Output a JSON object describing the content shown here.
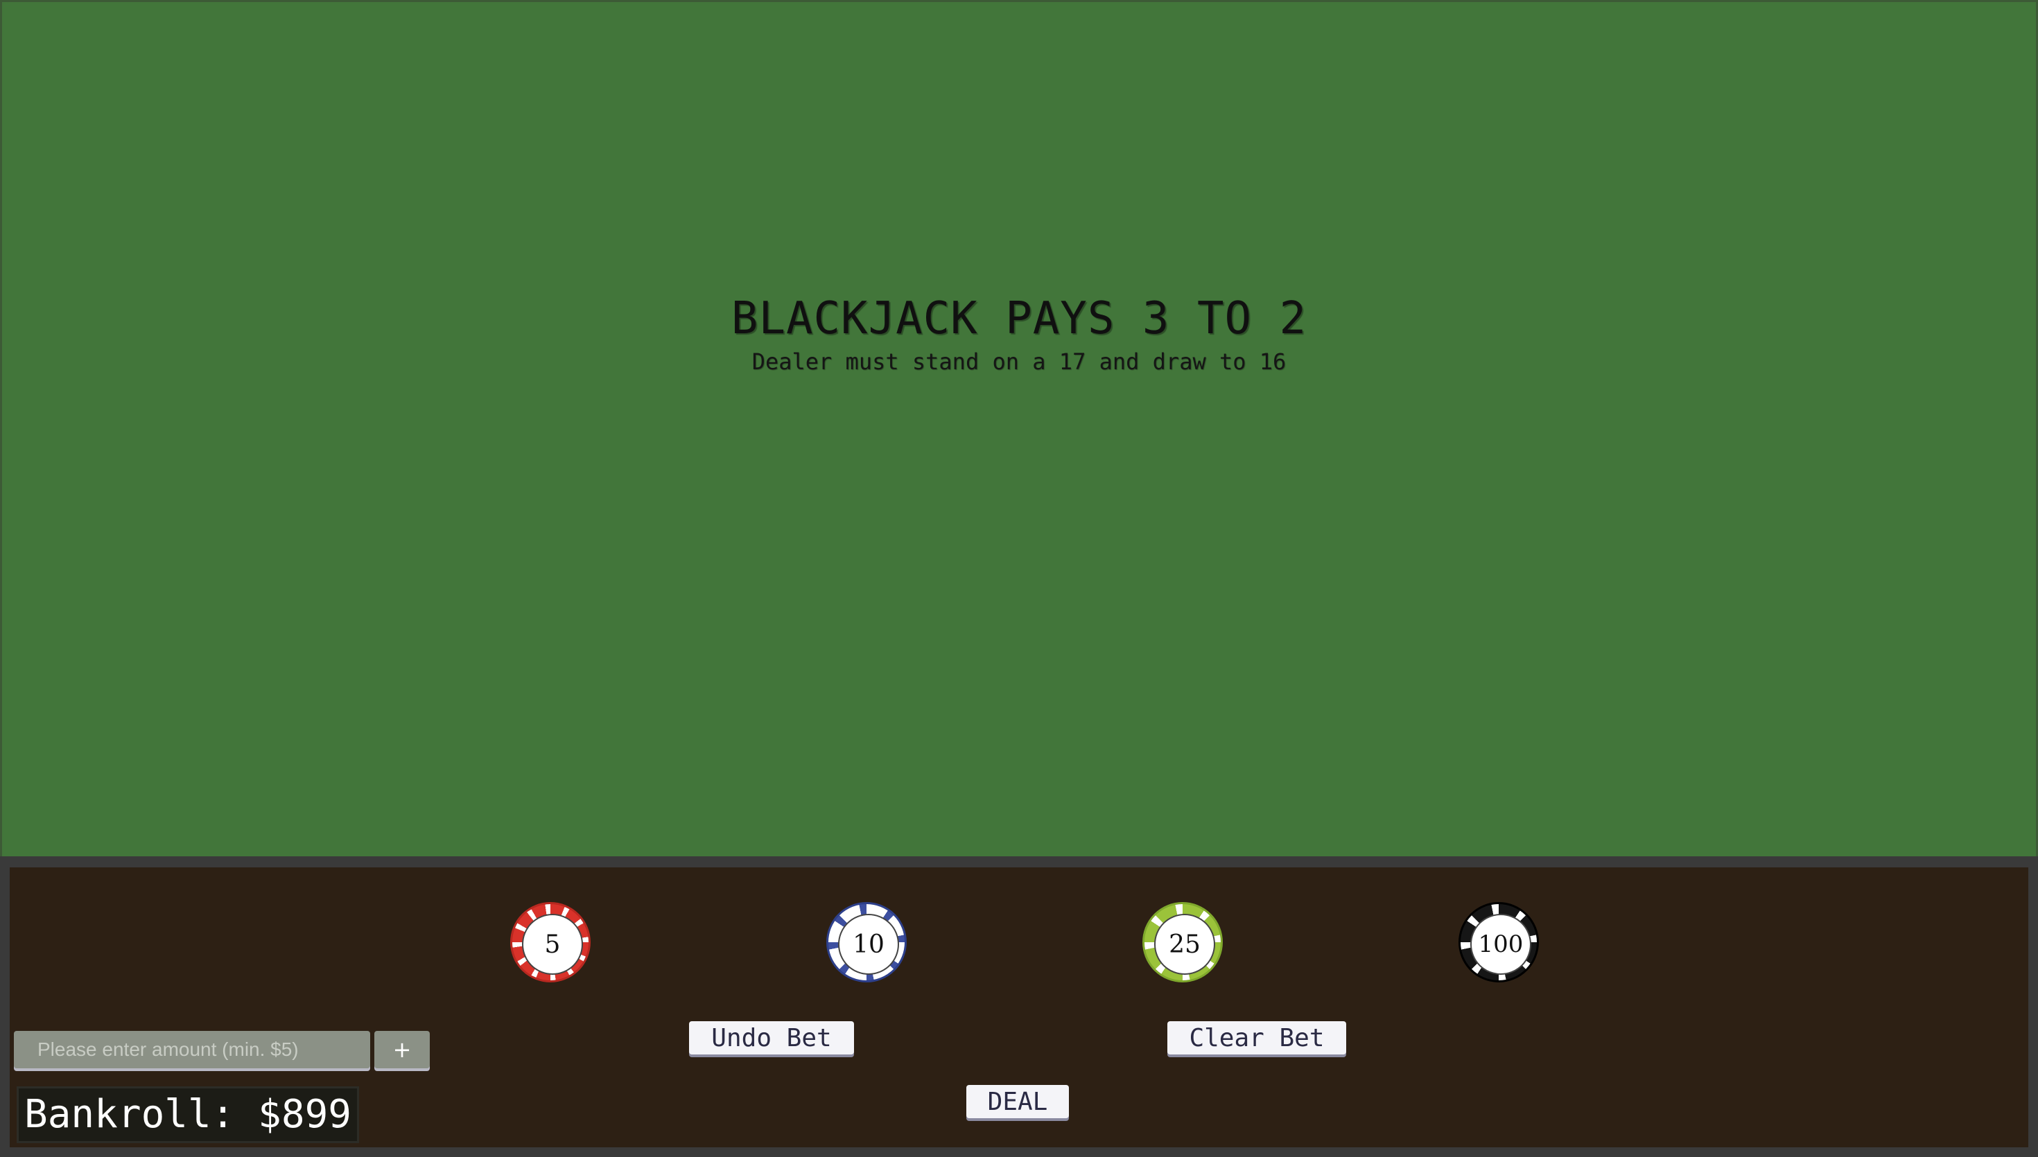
{
  "table": {
    "title": "BLACKJACK PAYS 3 TO 2",
    "subtitle": "Dealer must stand on a 17 and draw to 16",
    "felt_color": "#42763a"
  },
  "chips": [
    {
      "value": "5",
      "color": "#d9322a"
    },
    {
      "value": "10",
      "color": "#3d4fa0"
    },
    {
      "value": "25",
      "color": "#9bc33a"
    },
    {
      "value": "100",
      "color": "#161616"
    }
  ],
  "controls": {
    "undo_label": "Undo Bet",
    "clear_label": "Clear Bet",
    "deal_label": "DEAL",
    "amount_placeholder": "Please enter amount (min. $5)",
    "amount_value": "",
    "add_label": "+",
    "bankroll": "Bankroll: $899",
    "panel_color": "#2d2014"
  }
}
